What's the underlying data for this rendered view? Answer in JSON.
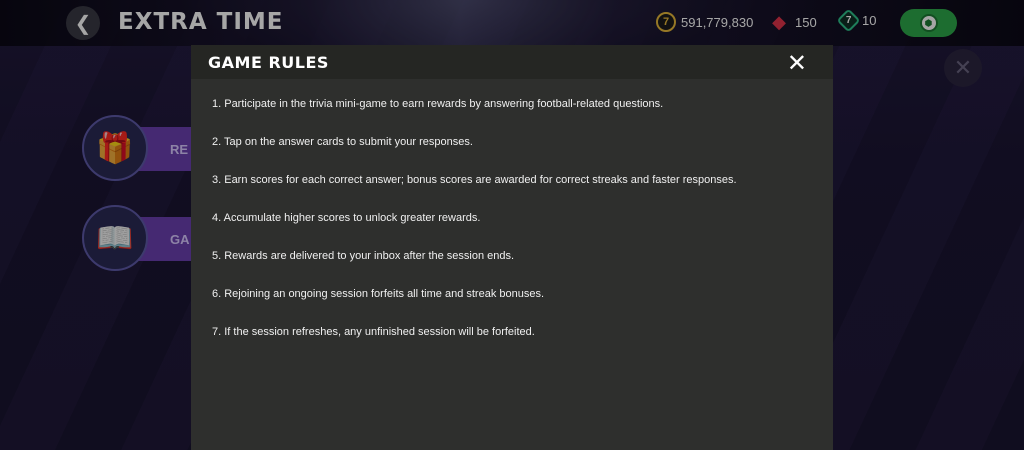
{
  "header": {
    "back_icon": "chevron-left-icon",
    "title": "EXTRA TIME",
    "currencies": [
      {
        "icon": "gold-coin-icon",
        "glyph": "7",
        "value": "591,779,830",
        "color": "#e6b83b"
      },
      {
        "icon": "red-gem-icon",
        "glyph": "◆",
        "value": "150",
        "color": "#e0344b"
      },
      {
        "icon": "green-token-icon",
        "glyph": "7",
        "value": "10",
        "color": "#2ec08a"
      }
    ],
    "play_icon": "soccer-ball-icon"
  },
  "background_buttons": [
    {
      "icon": "gift-icon",
      "glyph": "🎁",
      "label": "RE"
    },
    {
      "icon": "book-icon",
      "glyph": "📖",
      "label": "GA"
    }
  ],
  "modal": {
    "title": "GAME RULES",
    "close_glyph": "✕",
    "rules": [
      "1. Participate in the trivia mini-game to earn rewards by answering football-related questions.",
      "2. Tap on the answer cards to submit your responses.",
      "3. Earn scores for each correct answer; bonus scores are awarded for correct streaks and faster responses.",
      "4. Accumulate higher scores to unlock greater rewards.",
      "5. Rewards are delivered to your inbox after the session ends.",
      "6. Rejoining an ongoing session forfeits all time and streak bonuses.",
      "7. If the session refreshes, any unfinished session will be forfeited."
    ]
  },
  "bg_close_glyph": "✕"
}
